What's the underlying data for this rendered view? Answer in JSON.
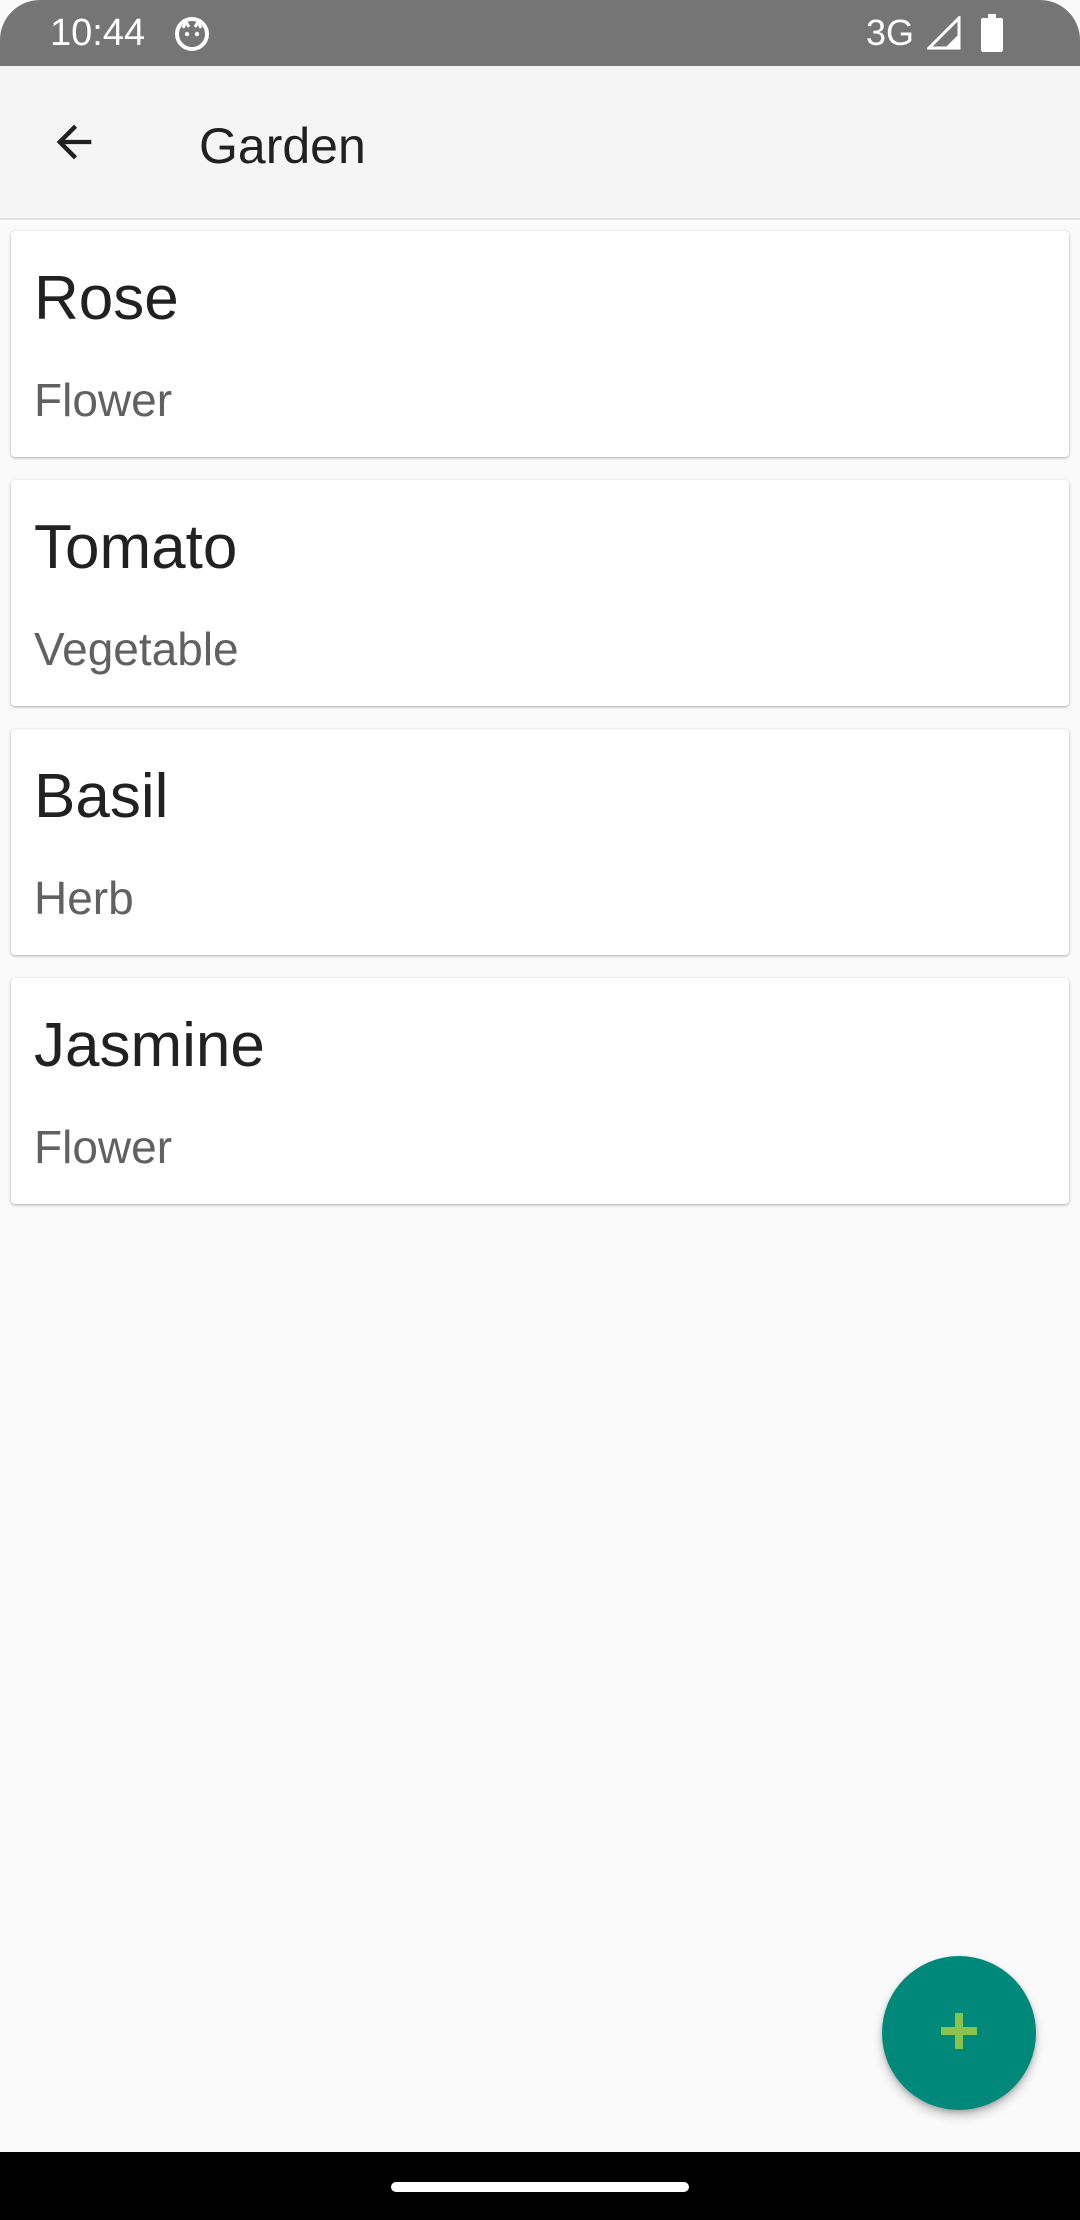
{
  "status_bar": {
    "time": "10:44",
    "network": "3G",
    "icons": [
      "cat-notification-icon",
      "cell-signal-icon",
      "battery-icon"
    ]
  },
  "app_bar": {
    "title": "Garden",
    "back_icon": "arrow-back-icon"
  },
  "plants": [
    {
      "name": "Rose",
      "type": "Flower"
    },
    {
      "name": "Tomato",
      "type": "Vegetable"
    },
    {
      "name": "Basil",
      "type": "Herb"
    },
    {
      "name": "Jasmine",
      "type": "Flower"
    }
  ],
  "fab": {
    "icon": "add-icon",
    "color": "#00897B",
    "icon_color": "#8BC34A"
  },
  "colors": {
    "status_bar": "#757575",
    "app_bar": "#F5F5F5",
    "background": "#FAFAFA",
    "card": "#FFFFFF",
    "primary_text": "#212121",
    "secondary_text": "#616161"
  }
}
